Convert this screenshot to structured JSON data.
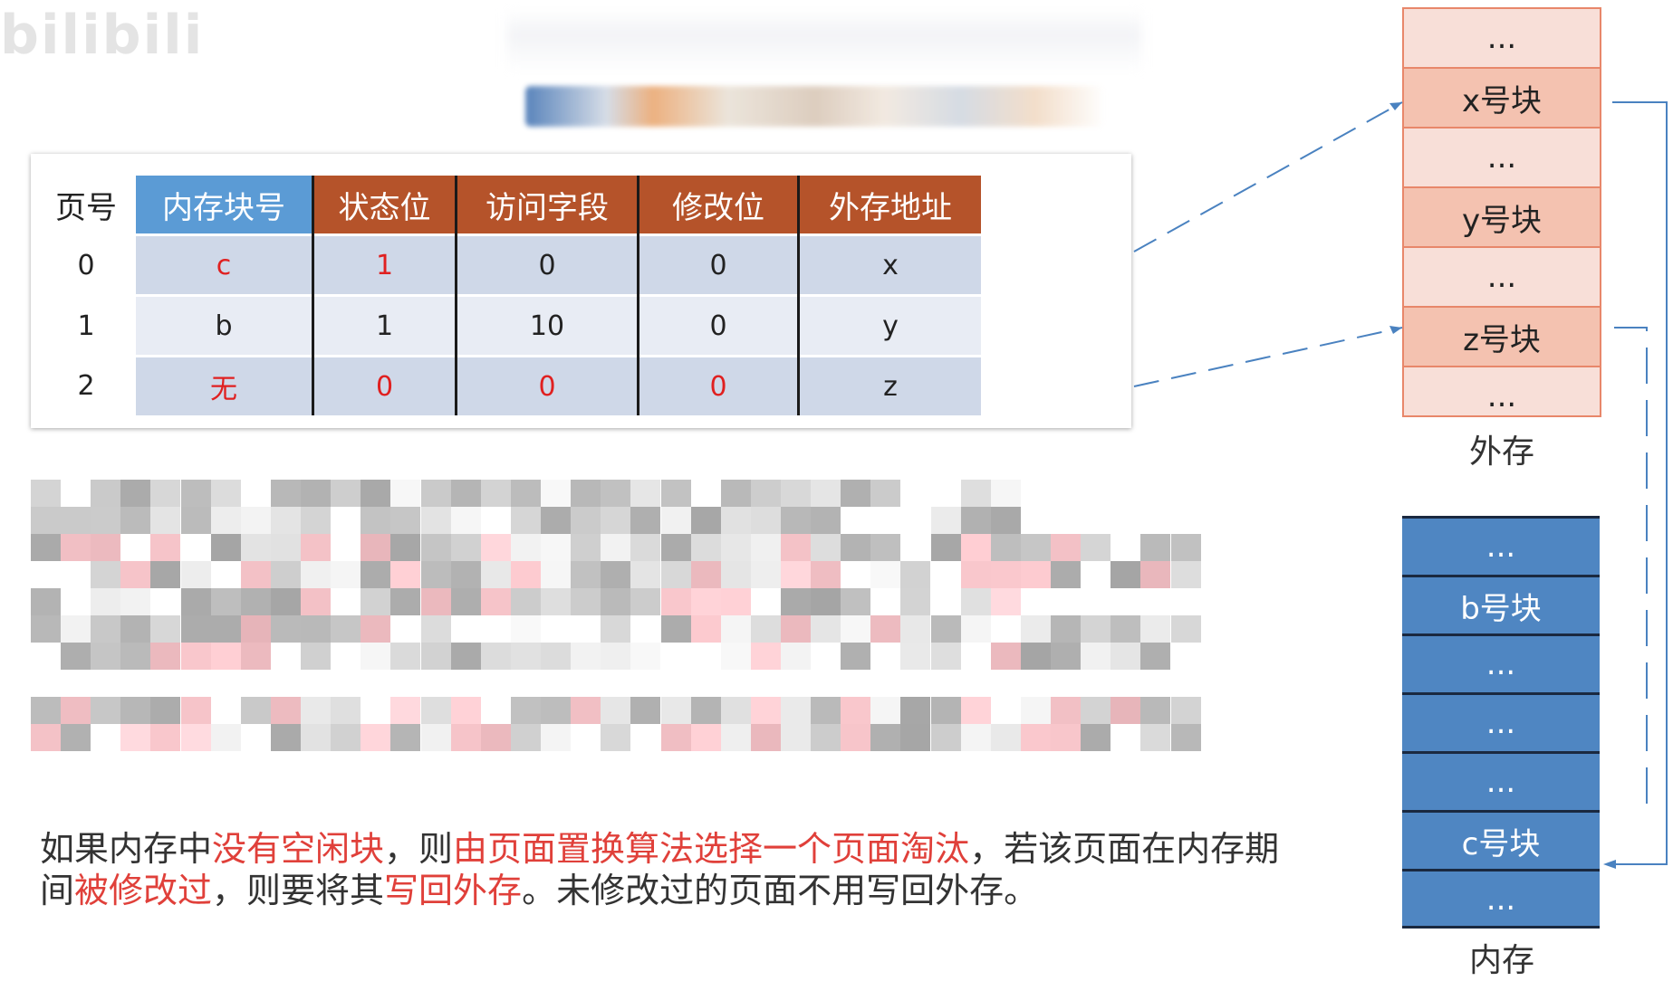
{
  "watermark": "bilibili",
  "table": {
    "headers": {
      "page": "页号",
      "block": "内存块号",
      "status": "状态位",
      "access": "访问字段",
      "modified": "修改位",
      "external": "外存地址"
    },
    "rows": [
      {
        "page": "0",
        "block": "c",
        "status": "1",
        "access": "0",
        "modified": "0",
        "external": "x"
      },
      {
        "page": "1",
        "block": "b",
        "status": "1",
        "access": "10",
        "modified": "0",
        "external": "y"
      },
      {
        "page": "2",
        "block": "无",
        "status": "0",
        "access": "0",
        "modified": "0",
        "external": "z"
      }
    ]
  },
  "external_storage": {
    "label": "外存",
    "cells": [
      "...",
      "x号块",
      "...",
      "y号块",
      "...",
      "z号块",
      "..."
    ]
  },
  "memory": {
    "label": "内存",
    "cells": [
      "...",
      "b号块",
      "...",
      "...",
      "...",
      "c号块",
      "..."
    ]
  },
  "caption": {
    "p1": "如果内存中",
    "h1": "没有空闲块",
    "p2": "，则",
    "h2": "由页面置换算法选择一个页面淘汰",
    "p3": "，若该页面在内存期间",
    "h3": "被修改过",
    "p4": "，则要将其",
    "h4": "写回外存",
    "p5": "。未修改过的页面不用写回外存。"
  },
  "colors": {
    "header_blue": "#5b9bd5",
    "header_brown": "#b5532a",
    "highlight_red": "#e02020",
    "external_fill": "#f8dfd8",
    "memory_fill": "#4f86c2"
  }
}
